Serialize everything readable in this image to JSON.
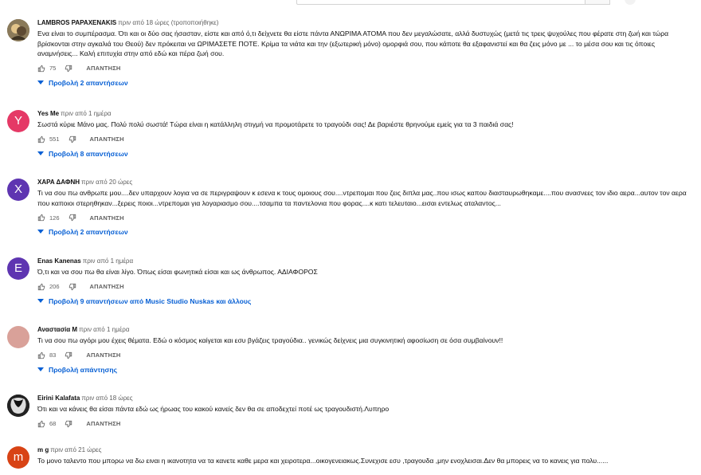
{
  "header": {
    "search_placeholder": ""
  },
  "comments": [
    {
      "author": "LAMBROS PAPAXENAKIS",
      "time": "πριν από 18 ώρες (τροποποιήθηκε)",
      "text": "Ενα είναι το συμπέρασμα. Ότι και οι δύο σας ήσασταν, είστε και από ό,τι δείχνετε θα είστε πάντα ΑΝΩΡΙΜΑ ΑΤΟΜΑ που δεν μεγαλώσατε, αλλά δυστυχώς (μετά τις τρεις ψυχούλες που φέρατε στη ζωή και τώρα βρίσκονται στην αγκαλιά του Θεού) δεν πρόκειται να ΩΡΙΜΑΣΕΤΕ ΠΟΤΕ. Κρίμα τα νιάτα και την (εξωτερική μόνο) ομορφιά σου, που κάποτε θα εξαφανιστεί και θα ζεις μόνο με ... το μέσα σου και τις όποιες αναμνήσεις... Καλή επιτυχία στην από εδώ και πέρα ζωή σου.",
      "likes": "75",
      "reply_label": "ΑΠΑΝΤΗΣΗ",
      "replies_label": "Προβολή 2 απαντήσεων",
      "avatar_letter": "",
      "avatar_color": "#7a6a4f"
    },
    {
      "author": "Yes Me",
      "time": "πριν από 1 ημέρα",
      "text": "Σωστά κύριε Μάνο μας. Πολύ πολύ σωστά! Τώρα είναι η κατάλληλη στιγμή να προμοτάρετε το τραγούδι σας! Δε βαριέστε θρηνούμε εμείς για τα 3 παιδιά σας!",
      "likes": "551",
      "reply_label": "ΑΠΑΝΤΗΣΗ",
      "replies_label": "Προβολή 8 απαντήσεων",
      "avatar_letter": "Y",
      "avatar_color": "#e53966"
    },
    {
      "author": "ΧΑΡΑ ΔΑΦΝΗ",
      "time": "πριν από 20 ώρες",
      "text": "Τι να σου πω ανθρωπε μου....δεν υπαρχουν λογια να σε περιγραψουν κ εσενα κ τους ομοιους σου....ντρεπομαι που ζεις διπλα μας..που ισως καπου διασταυρωθηκαμε....που ανασνεες τον ιδιο αερα...αυτον τον αερα που καποιοι στερηθηκαν...ξερεις ποιοι...ντρεπομαι για λογαριασμο σου....τσαμπα τα παντελονια που φορας....κ κατι τελευταιο...εισαι εντελως αταλαντος...",
      "likes": "126",
      "reply_label": "ΑΠΑΝΤΗΣΗ",
      "replies_label": "Προβολή 2 απαντήσεων",
      "avatar_letter": "X",
      "avatar_color": "#5e35b1"
    },
    {
      "author": "Enas Kanenas",
      "time": "πριν από 1 ημέρα",
      "text": "Ό,τι και να σου πω θα είναι λίγο. Όπως είσαι φωνητικά είσαι και ως άνθρωπος. ΑΔΙΑΦΟΡΟΣ",
      "likes": "206",
      "reply_label": "ΑΠΑΝΤΗΣΗ",
      "replies_label": "Προβολή 9 απαντήσεων από Music Studio Nuskas και άλλους",
      "avatar_letter": "E",
      "avatar_color": "#5e35b1"
    },
    {
      "author": "Αναστασία Μ",
      "time": "πριν από 1 ημέρα",
      "text": "Τι να σου πω αγόρι μου έχεις θέματα. Εδώ ο κόσμος καίγεται και εσυ βγάζεις τραγούδια.. γενικώς δείχνεις μια συγκινητική αφοσίωση σε όσα συμβαίνουν!!",
      "likes": "83",
      "reply_label": "ΑΠΑΝΤΗΣΗ",
      "replies_label": "Προβολή απάντησης",
      "avatar_letter": "",
      "avatar_color": "#d9a199"
    },
    {
      "author": "Eirini Kalafata",
      "time": "πριν από 18 ώρες",
      "text": "Ότι και να κάνεις θα είσαι πάντα εδώ ως ήρωας του κακού κανείς δεν θα σε αποδεχτεί ποτέ ως τραγουδιστή.Λυπηρο",
      "likes": "68",
      "reply_label": "ΑΠΑΝΤΗΣΗ",
      "replies_label": "",
      "avatar_letter": "",
      "avatar_color": "#1e1e1e"
    },
    {
      "author": "m g",
      "time": "πριν από 21 ώρες",
      "text": "Το μονο ταλεντο που μπορω να δω ειναι η ικανοτητα να τα κανετε καθε μερα και χειροτερα...οικογενειακως.Συνεχισε εσυ ,τραγουδα ,μην ενοχλεισαι.Δεν θα μπορεις να το κανεις για  πολυ......",
      "likes": "",
      "reply_label": "",
      "replies_label": "",
      "avatar_letter": "m",
      "avatar_color": "#d84315"
    }
  ]
}
